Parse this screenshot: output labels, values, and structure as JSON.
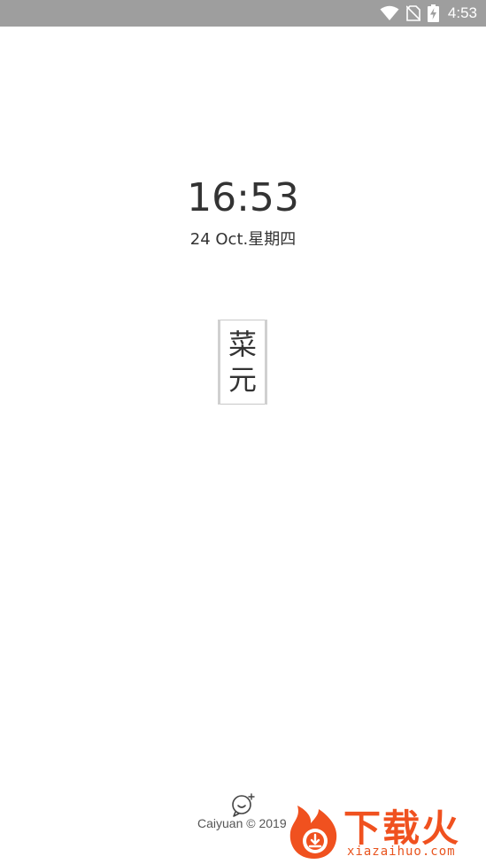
{
  "status_bar": {
    "time": "4:53",
    "icons": [
      "wifi-icon",
      "no-sim-icon",
      "battery-charging-icon"
    ],
    "background": "#9e9e9e"
  },
  "lock": {
    "time": "16:53",
    "date": "24 Oct.星期四"
  },
  "logo": {
    "text": "菜元"
  },
  "footer": {
    "icon": "chat-bubble-icon",
    "copyright": "Caiyuan © 2019"
  },
  "watermark": {
    "title": "下载火",
    "url": "xiazaihuo.com",
    "color": "#f0511f"
  }
}
